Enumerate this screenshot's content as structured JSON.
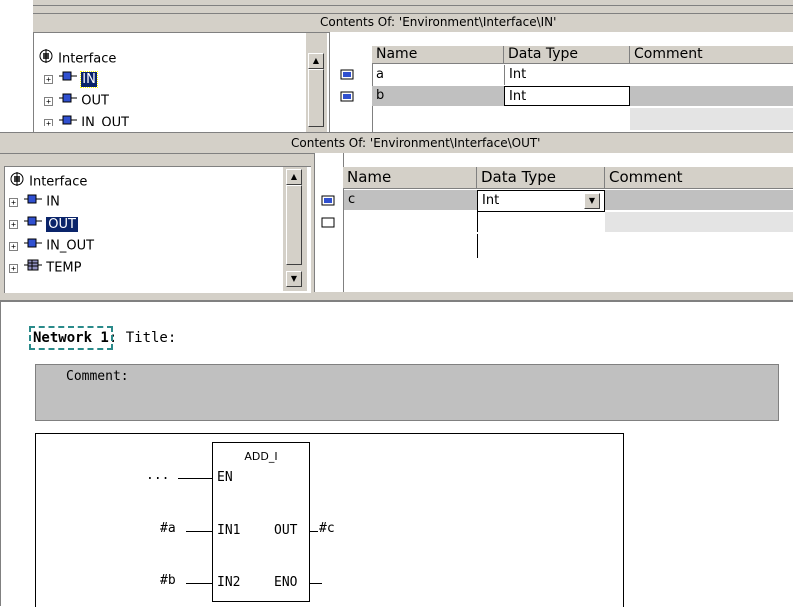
{
  "back_window": {
    "header_title": "Contents Of: 'Environment\\Interface\\IN'",
    "tree": [
      {
        "label": "Interface"
      },
      {
        "label": "IN"
      },
      {
        "label": "OUT"
      },
      {
        "label": "IN_OUT"
      }
    ],
    "columns": [
      "Name",
      "Data Type",
      "Comment"
    ],
    "rows": [
      {
        "name": "a",
        "type": "Int",
        "comment": ""
      },
      {
        "name": "b",
        "type": "Int",
        "comment": ""
      }
    ]
  },
  "front_window": {
    "header_title": "Contents Of: 'Environment\\Interface\\OUT'",
    "tree": [
      {
        "label": "Interface"
      },
      {
        "label": "IN"
      },
      {
        "label": "OUT"
      },
      {
        "label": "IN_OUT"
      },
      {
        "label": "TEMP"
      }
    ],
    "columns": [
      "Name",
      "Data Type",
      "Comment"
    ],
    "rows": [
      {
        "name": "c",
        "type": "Int",
        "comment": ""
      },
      {
        "name": "",
        "type": "",
        "comment": ""
      }
    ]
  },
  "network": {
    "label": "Network 1",
    "title_suffix": ": Title:",
    "comment_label": "Comment:",
    "block": {
      "name": "ADD_I",
      "en": "EN",
      "in1": "IN1",
      "in2": "IN2",
      "out": "OUT",
      "eno": "ENO",
      "en_input": "...",
      "in1_input": "#a",
      "in2_input": "#b",
      "out_output": "#c"
    }
  },
  "colors": {
    "selection": "#0a246a",
    "panel_gray": "#d4d0c8",
    "row_gray": "#c0c0c0"
  }
}
